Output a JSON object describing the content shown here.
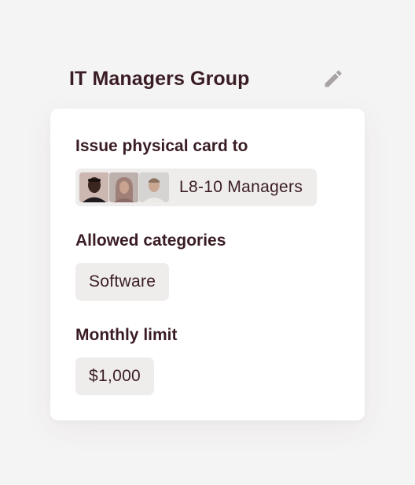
{
  "group": {
    "title": "IT Managers Group",
    "edit_icon": "pencil-icon"
  },
  "card": {
    "issue_label": "Issue physical card to",
    "audience": {
      "label": "L8-10 Managers",
      "avatars": [
        "avatar-person-1",
        "avatar-person-2",
        "avatar-person-3"
      ]
    },
    "categories_label": "Allowed categories",
    "categories": [
      "Software"
    ],
    "limit_label": "Monthly limit",
    "limit_value": "$1,000"
  },
  "colors": {
    "background": "#f5f4f4",
    "card": "#ffffff",
    "pill": "#efecec",
    "text": "#3a1d24",
    "icon": "#a8a3a5"
  }
}
